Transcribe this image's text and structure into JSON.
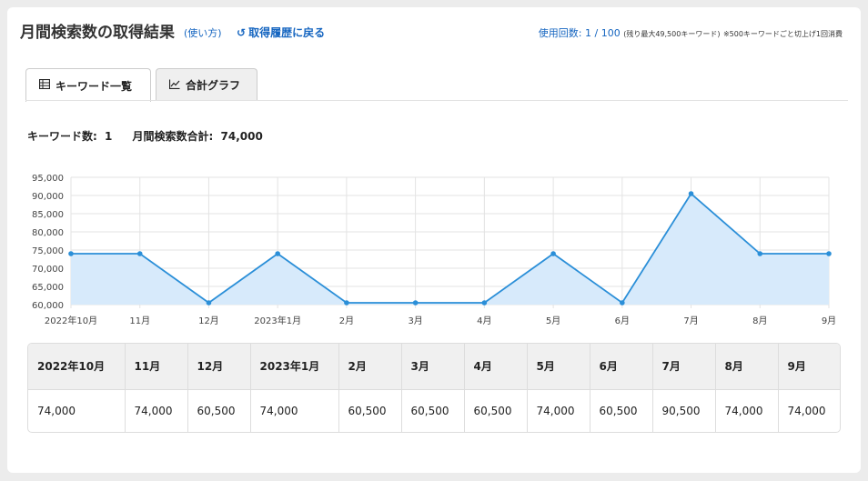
{
  "header": {
    "title": "月間検索数の取得結果",
    "help_link": "(使い方)",
    "back_link": "取得履歴に戻る",
    "back_icon": "undo-icon",
    "usage_label": "使用回数: 1 / 100",
    "usage_remaining": "(残り最大49,500キーワード)",
    "usage_note": "※500キーワードごと切上げ1回消費"
  },
  "tabs": [
    {
      "label": "キーワード一覧",
      "icon": "table-icon",
      "active": true
    },
    {
      "label": "合計グラフ",
      "icon": "line-chart-icon",
      "active": false
    }
  ],
  "summary": {
    "keyword_count_label": "キーワード数:",
    "keyword_count": "1",
    "total_label": "月間検索数合計:",
    "total": "74,000"
  },
  "chart_data": {
    "type": "area",
    "categories": [
      "2022年10月",
      "11月",
      "12月",
      "2023年1月",
      "2月",
      "3月",
      "4月",
      "5月",
      "6月",
      "7月",
      "8月",
      "9月"
    ],
    "values": [
      74000,
      74000,
      60500,
      74000,
      60500,
      60500,
      60500,
      74000,
      60500,
      90500,
      74000,
      74000
    ],
    "ylim": [
      60000,
      95000
    ],
    "yticks": [
      "95,000",
      "90,000",
      "85,000",
      "80,000",
      "75,000",
      "70,000",
      "65,000",
      "60,000"
    ],
    "grid": true,
    "line_color": "#2b8fd8",
    "fill_color": "#d7eafb"
  },
  "table": {
    "headers": [
      "2022年10月",
      "11月",
      "12月",
      "2023年1月",
      "2月",
      "3月",
      "4月",
      "5月",
      "6月",
      "7月",
      "8月",
      "9月"
    ],
    "values": [
      "74,000",
      "74,000",
      "60,500",
      "74,000",
      "60,500",
      "60,500",
      "60,500",
      "74,000",
      "60,500",
      "90,500",
      "74,000",
      "74,000"
    ]
  }
}
